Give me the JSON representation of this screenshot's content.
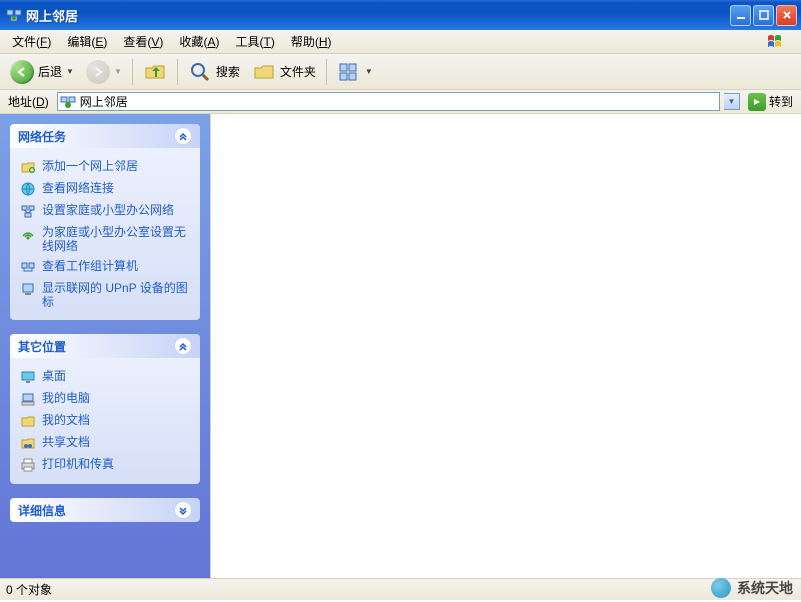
{
  "window": {
    "title": "网上邻居"
  },
  "menus": {
    "file": {
      "label": "文件",
      "accel": "F"
    },
    "edit": {
      "label": "编辑",
      "accel": "E"
    },
    "view": {
      "label": "查看",
      "accel": "V"
    },
    "favorites": {
      "label": "收藏",
      "accel": "A"
    },
    "tools": {
      "label": "工具",
      "accel": "T"
    },
    "help": {
      "label": "帮助",
      "accel": "H"
    }
  },
  "toolbar": {
    "back": "后退",
    "search": "搜索",
    "folders": "文件夹"
  },
  "address": {
    "label": "地址",
    "accel": "D",
    "value": "网上邻居",
    "go": "转到"
  },
  "sidebar": {
    "network_tasks": {
      "title": "网络任务",
      "items": [
        "添加一个网上邻居",
        "查看网络连接",
        "设置家庭或小型办公网络",
        "为家庭或小型办公室设置无线网络",
        "查看工作组计算机",
        "显示联网的 UPnP 设备的图标"
      ]
    },
    "other_places": {
      "title": "其它位置",
      "items": [
        "桌面",
        "我的电脑",
        "我的文档",
        "共享文档",
        "打印机和传真"
      ]
    },
    "details": {
      "title": "详细信息"
    }
  },
  "statusbar": {
    "text": "0 个对象"
  },
  "watermark": {
    "text": "系统天地"
  }
}
